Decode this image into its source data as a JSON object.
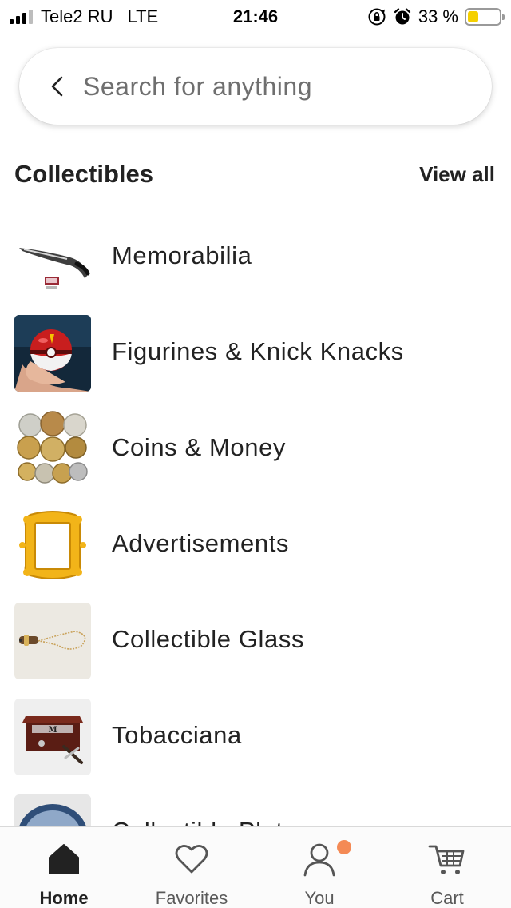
{
  "status_bar": {
    "carrier": "Tele2 RU",
    "network": "LTE",
    "time": "21:46",
    "battery_text": "33 %",
    "battery_level": 0.33,
    "icons": [
      "signal-icon",
      "rotation-lock-icon",
      "alarm-icon",
      "battery-icon"
    ]
  },
  "search": {
    "placeholder": "Search for anything",
    "value": ""
  },
  "section": {
    "title": "Collectibles",
    "view_all_label": "View all"
  },
  "categories": [
    {
      "label": "Memorabilia",
      "thumb": "memorabilia-knife-image"
    },
    {
      "label": "Figurines & Knick Knacks",
      "thumb": "figurine-ball-image"
    },
    {
      "label": "Coins & Money",
      "thumb": "coins-image"
    },
    {
      "label": "Advertisements",
      "thumb": "yellow-frame-image"
    },
    {
      "label": "Collectible Glass",
      "thumb": "glass-pendant-image"
    },
    {
      "label": "Tobacciana",
      "thumb": "humidor-image"
    },
    {
      "label": "Collectible Plates",
      "thumb": "plate-image"
    }
  ],
  "bottom_nav": {
    "items": [
      {
        "label": "Home",
        "icon": "home-icon",
        "active": true
      },
      {
        "label": "Favorites",
        "icon": "heart-icon",
        "active": false
      },
      {
        "label": "You",
        "icon": "user-icon",
        "active": false,
        "badge": true
      },
      {
        "label": "Cart",
        "icon": "cart-icon",
        "active": false
      }
    ]
  },
  "colors": {
    "accent_badge": "#f1641e",
    "battery": "#f5d000",
    "text": "#222222",
    "muted_text": "#595959"
  }
}
